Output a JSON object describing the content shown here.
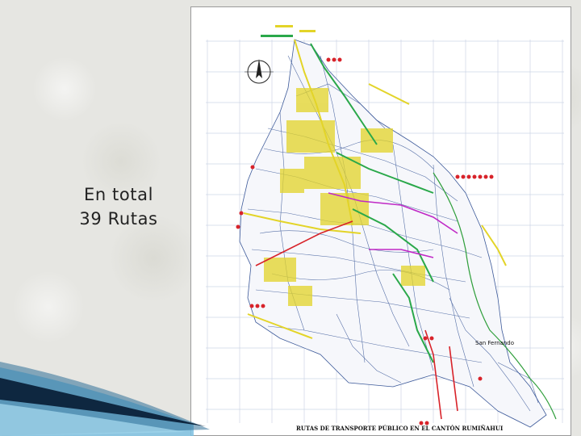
{
  "slide": {
    "caption_line1": "En total",
    "caption_line2": "39 Rutas"
  },
  "map": {
    "footer_title": "RUTAS DE TRANSPORTE PÚBLICO EN EL CANTÓN RUMIÑAHUI",
    "place_label": "San Fernando",
    "north_label": "NORTE",
    "colors": {
      "grid": "#cdd6e6",
      "streets": "#3d5a9a",
      "yellow_routes": "#e3d428",
      "green_routes": "#2aa84a",
      "red_routes": "#d8232a",
      "magenta_routes": "#c02ac6",
      "river": "#2e9e3a"
    }
  },
  "decoration": {
    "swoosh_dark": "#0e2740",
    "swoosh_light": "#7cc0e0"
  }
}
